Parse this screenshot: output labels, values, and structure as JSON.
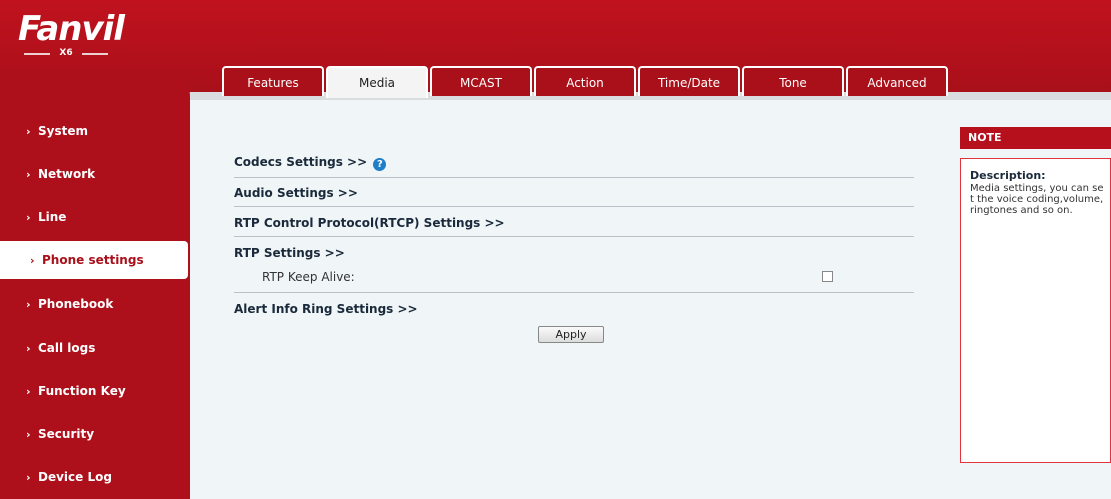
{
  "brand": {
    "logo_text": "Fanvil",
    "model": "X6"
  },
  "tabs": [
    {
      "label": "Features",
      "active": false
    },
    {
      "label": "Media",
      "active": true
    },
    {
      "label": "MCAST",
      "active": false
    },
    {
      "label": "Action",
      "active": false
    },
    {
      "label": "Time/Date",
      "active": false
    },
    {
      "label": "Tone",
      "active": false
    },
    {
      "label": "Advanced",
      "active": false
    }
  ],
  "sidebar": {
    "items": [
      {
        "label": "System",
        "active": false
      },
      {
        "label": "Network",
        "active": false
      },
      {
        "label": "Line",
        "active": false
      },
      {
        "label": "Phone settings",
        "active": true
      },
      {
        "label": "Phonebook",
        "active": false
      },
      {
        "label": "Call logs",
        "active": false
      },
      {
        "label": "Function Key",
        "active": false
      },
      {
        "label": "Security",
        "active": false
      },
      {
        "label": "Device Log",
        "active": false
      }
    ]
  },
  "main": {
    "sections": {
      "codecs": "Codecs Settings >>",
      "audio": "Audio Settings >>",
      "rtcp": "RTP Control Protocol(RTCP) Settings >>",
      "rtp": "RTP Settings >>",
      "alert": "Alert Info Ring Settings >>"
    },
    "rtp_keep_alive": {
      "label": "RTP Keep Alive:",
      "checked": false
    },
    "apply_label": "Apply"
  },
  "note": {
    "header": "NOTE",
    "title": "Description:",
    "text": "Media settings, you can set the voice coding,volume,ringtones and so on."
  },
  "colors": {
    "brand_red": "#a9101a",
    "accent_blue": "#1f7ec8"
  }
}
